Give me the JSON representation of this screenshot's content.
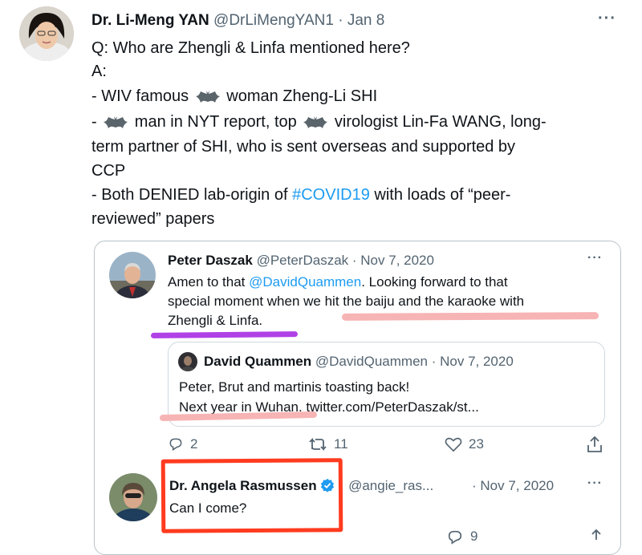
{
  "main_tweet": {
    "author_name": "Dr. Li-Meng YAN",
    "handle": "@DrLiMengYAN1",
    "date": "Jan 8",
    "more": "···",
    "text": {
      "l1": "Q: Who are Zhengli & Linfa mentioned here?",
      "l2": "A:",
      "l3a": "- WIV famous",
      "l3b": "woman Zheng-Li SHI",
      "l4a": "-",
      "l4b": "man in NYT report, top",
      "l4c": "virologist Lin-Fa WANG, long-",
      "l5": "term partner of SHI, who is sent overseas and supported by",
      "l6": "CCP",
      "l7a": "- Both DENIED lab-origin of",
      "l7_hashtag": "#COVID19",
      "l7b": "with loads of “peer-",
      "l8": "reviewed” papers"
    }
  },
  "quoted_tweet": {
    "author_name": "Peter Daszak",
    "handle": "@PeterDaszak",
    "date": "Nov 7, 2020",
    "more": "···",
    "l1a": "Amen to that",
    "l1_mention": "@DavidQuammen",
    "l1b": ". Looking forward to that",
    "l2": "special moment when we hit the baiju and the karaoke with",
    "l3": "Zhengli & Linfa.",
    "actions": {
      "reply_count": "2",
      "retweet_count": "11",
      "like_count": "23"
    }
  },
  "nested_quote": {
    "author_name": "David Quammen",
    "handle": "@DavidQuammen",
    "date": "Nov 7, 2020",
    "l1": "Peter, Brut and martinis toasting back!",
    "l2": "Next year in Wuhan. twitter.com/PeterDaszak/st..."
  },
  "reply": {
    "author_name": "Dr. Angela Rasmussen",
    "handle": "@angie_ras...",
    "date": "Nov 7, 2020",
    "more": "···",
    "text": "Can I come?",
    "actions": {
      "reply_count": "",
      "retweet_count": "",
      "like_count": "9"
    }
  },
  "colors": {
    "link": "#1d9bf0",
    "muted": "#536471",
    "verified": "#1d9bf0",
    "highlight_purple": "#b041e6",
    "highlight_pink": "#f7b4b4",
    "box_red": "#ff3b1f"
  }
}
